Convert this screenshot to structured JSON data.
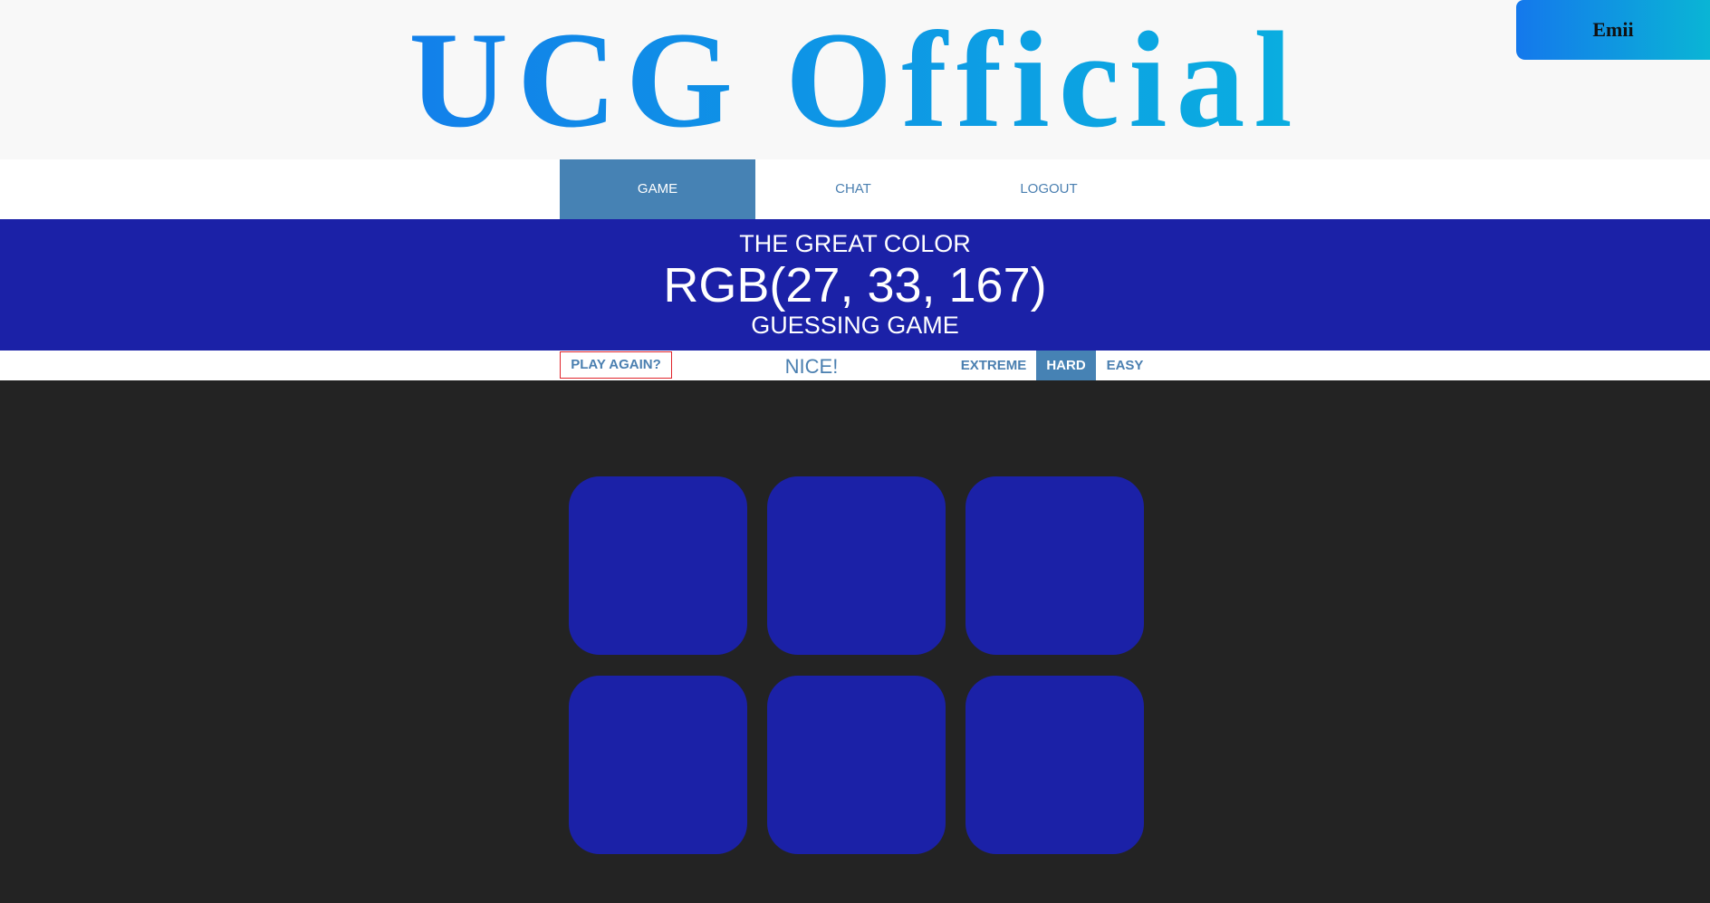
{
  "header": {
    "site_title": "UCG Official",
    "user_name": "Emii"
  },
  "nav": {
    "items": [
      {
        "label": "GAME",
        "active": true
      },
      {
        "label": "CHAT",
        "active": false
      },
      {
        "label": "LOGOUT",
        "active": false
      }
    ]
  },
  "game": {
    "title_top": "THE GREAT COLOR",
    "target_rgb": "RGB(27, 33, 167)",
    "title_bottom": "GUESSING GAME",
    "play_again_label": "PLAY AGAIN?",
    "message": "NICE!",
    "modes": [
      {
        "label": "EXTREME",
        "selected": false
      },
      {
        "label": "HARD",
        "selected": true
      },
      {
        "label": "EASY",
        "selected": false
      }
    ],
    "squares": [
      "#1b21a7",
      "#1b21a7",
      "#1b21a7",
      "#1b21a7",
      "#1b21a7",
      "#1b21a7"
    ]
  },
  "colors": {
    "target_color": "#1b21a7",
    "accent": "#4682b4",
    "board_background": "#232323",
    "header_gradient_start": "#1280ea",
    "header_gradient_end": "#0aaee0"
  }
}
